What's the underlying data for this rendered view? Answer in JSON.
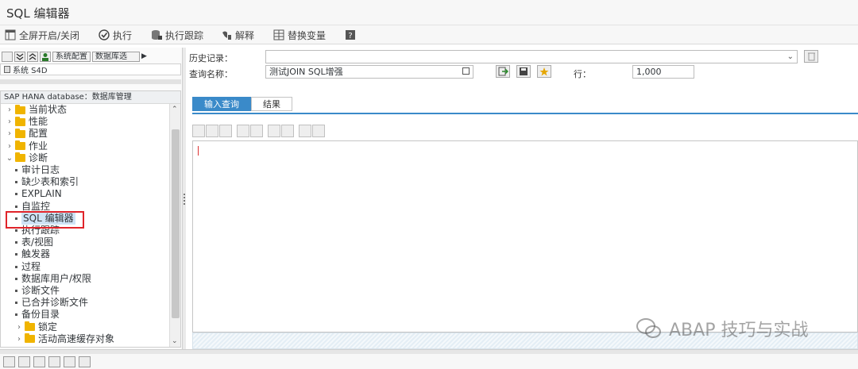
{
  "window": {
    "title": "SQL 编辑器"
  },
  "toolbar": {
    "fullscreen": "全屏开启/关闭",
    "execute": "执行",
    "exec_trace": "执行跟踪",
    "explain": "解释",
    "replace_vars": "替换变量"
  },
  "left_panel": {
    "toolbar": {
      "system_config": "系统配置",
      "db_select": "数据库选"
    },
    "system_label": "系统 S4D",
    "tree_header": "SAP HANA database：数据库管理",
    "tree": [
      {
        "label": "当前状态",
        "kind": "folder"
      },
      {
        "label": "性能",
        "kind": "folder"
      },
      {
        "label": "配置",
        "kind": "folder"
      },
      {
        "label": "作业",
        "kind": "folder"
      },
      {
        "label": "诊断",
        "kind": "folder-open"
      },
      {
        "label": "审计日志",
        "kind": "leaf"
      },
      {
        "label": "缺少表和索引",
        "kind": "leaf"
      },
      {
        "label": "EXPLAIN",
        "kind": "leaf"
      },
      {
        "label": "自监控",
        "kind": "leaf"
      },
      {
        "label": "SQL 编辑器",
        "kind": "leaf",
        "selected": true
      },
      {
        "label": "执行跟踪",
        "kind": "leaf"
      },
      {
        "label": "表/视图",
        "kind": "leaf"
      },
      {
        "label": "触发器",
        "kind": "leaf"
      },
      {
        "label": "过程",
        "kind": "leaf"
      },
      {
        "label": "数据库用户/权限",
        "kind": "leaf"
      },
      {
        "label": "诊断文件",
        "kind": "leaf"
      },
      {
        "label": "已合并诊断文件",
        "kind": "leaf"
      },
      {
        "label": "备份目录",
        "kind": "leaf"
      },
      {
        "label": "锁定",
        "kind": "folder-sub"
      },
      {
        "label": "活动高速缓存对象",
        "kind": "folder-sub"
      }
    ]
  },
  "form": {
    "history_label": "历史记录：",
    "history_value": "",
    "query_name_label": "查询名称：",
    "query_name_value": "测试JOIN SQL增强",
    "rows_label": "行：",
    "rows_value": "1,000"
  },
  "tabs": {
    "input": "输入查询",
    "result": "结果"
  },
  "watermark": "ABAP 技巧与实战",
  "colors": {
    "accent": "#3a8ac9",
    "highlight": "#e0242a",
    "folder": "#f0b400"
  }
}
